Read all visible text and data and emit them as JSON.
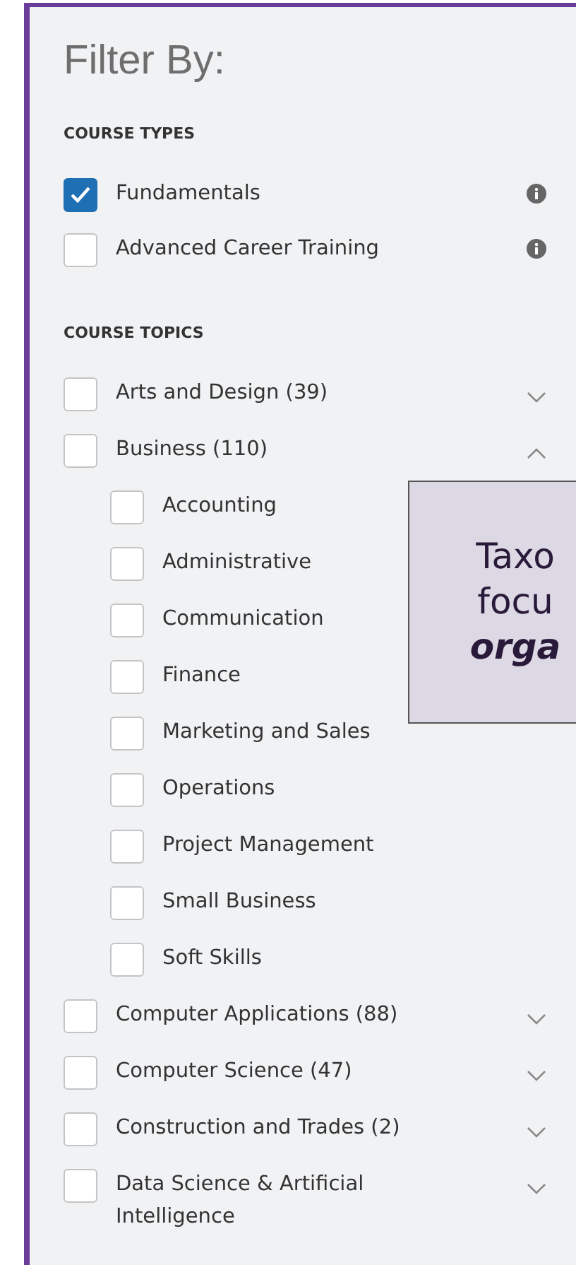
{
  "title": "Filter By:",
  "course_types": {
    "heading": "COURSE TYPES",
    "items": [
      {
        "label": "Fundamentals",
        "checked": true
      },
      {
        "label": "Advanced Career Training",
        "checked": false
      }
    ]
  },
  "course_topics": {
    "heading": "COURSE TOPICS",
    "items": [
      {
        "label": "Arts and Design (39)",
        "checked": false,
        "expanded": false
      },
      {
        "label": "Business (110)",
        "checked": false,
        "expanded": true,
        "children": [
          {
            "label": "Accounting",
            "checked": false
          },
          {
            "label": "Administrative",
            "checked": false
          },
          {
            "label": "Communication",
            "checked": false
          },
          {
            "label": "Finance",
            "checked": false
          },
          {
            "label": "Marketing and Sales",
            "checked": false
          },
          {
            "label": "Operations",
            "checked": false
          },
          {
            "label": "Project Management",
            "checked": false
          },
          {
            "label": "Small Business",
            "checked": false
          },
          {
            "label": "Soft Skills",
            "checked": false
          }
        ]
      },
      {
        "label": "Computer Applications (88)",
        "checked": false,
        "expanded": false
      },
      {
        "label": "Computer Science (47)",
        "checked": false,
        "expanded": false
      },
      {
        "label": "Construction and Trades (2)",
        "checked": false,
        "expanded": false
      },
      {
        "label": "Data Science & Artificial Intelligence",
        "checked": false,
        "expanded": false
      }
    ]
  },
  "callout": {
    "lines": [
      {
        "text": "Taxo",
        "kind": "plain"
      },
      {
        "text": "focu",
        "kind": "plain"
      },
      {
        "text": "orga",
        "kind": "emphasis"
      }
    ]
  }
}
